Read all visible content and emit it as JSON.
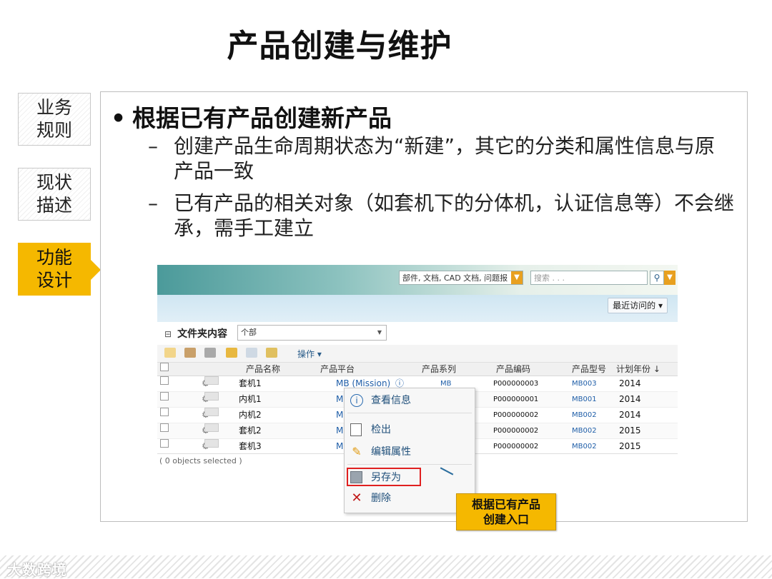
{
  "slide": {
    "title": "产品创建与维护",
    "tabs": [
      {
        "label": "业务\n规则",
        "active": false
      },
      {
        "label": "现状\n描述",
        "active": false
      },
      {
        "label": "功能\n设计",
        "active": true
      }
    ],
    "bullet": "根据已有产品创建新产品",
    "subbullets": [
      "创建产品生命周期状态为“新建”，其它的分类和属性信息与原产品一致",
      "已有产品的相关对象（如套机下的分体机，认证信息等）不会继承，需手工建立"
    ],
    "callout": "根据已有产品\n创建入口",
    "footer_brand": "大数跨境",
    "accent_color": "#f5b800"
  },
  "app": {
    "search_scope": "部件, 文档, CAD 文档, 问题报",
    "search_placeholder": "搜索 . . .",
    "recent_label": "最近访问的 ▾",
    "folder_title": "文件夹内容",
    "view_value": "个部",
    "actions_label": "操作 ▾",
    "columns": [
      "产品名称",
      "产品平台",
      "产品系列",
      "产品编码",
      "产品型号",
      "计划年份 ↓"
    ],
    "rows": [
      {
        "name": "套机1",
        "platform": "MB (Mission)",
        "series": "MB",
        "code": "P000000003",
        "model": "MB003",
        "year": "2014"
      },
      {
        "name": "内机1",
        "platform": "M",
        "series": "",
        "code": "P000000001",
        "model": "MB001",
        "year": "2014"
      },
      {
        "name": "内机2",
        "platform": "M",
        "series": "",
        "code": "P000000002",
        "model": "MB002",
        "year": "2014"
      },
      {
        "name": "套机2",
        "platform": "M",
        "series": "",
        "code": "P000000002",
        "model": "MB002",
        "year": "2015"
      },
      {
        "name": "套机3",
        "platform": "M",
        "series": "",
        "code": "P000000002",
        "model": "MB002",
        "year": "2015"
      }
    ],
    "selection_status": "( 0 objects selected )",
    "context_menu": [
      {
        "label": "查看信息",
        "icon": "info-icon"
      },
      {
        "label": "检出",
        "icon": "checkout-icon"
      },
      {
        "label": "编辑属性",
        "icon": "pencil-icon"
      },
      {
        "label": "另存为",
        "icon": "save-as-icon"
      },
      {
        "label": "删除",
        "icon": "delete-icon"
      }
    ]
  }
}
